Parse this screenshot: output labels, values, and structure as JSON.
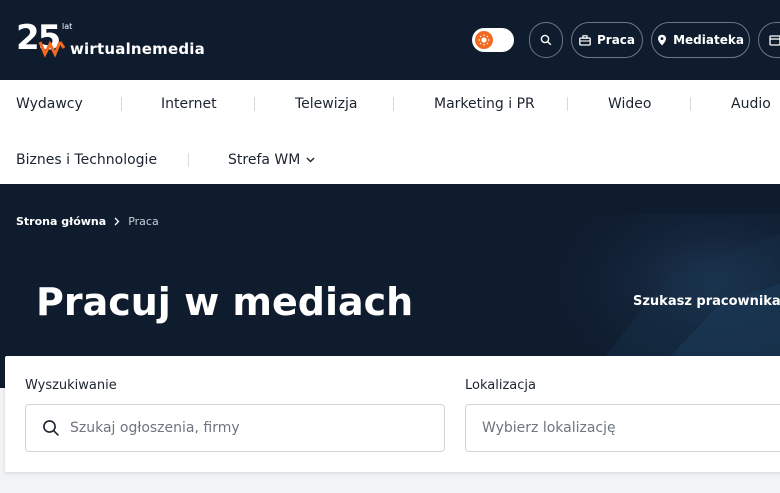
{
  "logo": {
    "number": "25",
    "suffix": "lat",
    "wordmark": "wirtualnemedia"
  },
  "header": {
    "praca_label": "Praca",
    "mediateka_label": "Mediateka"
  },
  "nav": {
    "items": [
      "Wydawcy",
      "Internet",
      "Telewizja",
      "Marketing i PR",
      "Wideo",
      "Audio",
      "Biznes i Technologie",
      "Strefa WM"
    ]
  },
  "breadcrumb": {
    "home": "Strona główna",
    "current": "Praca"
  },
  "hero": {
    "title": "Pracuj w mediach",
    "cta": "Szukasz pracownika?"
  },
  "search": {
    "label": "Wyszukiwanie",
    "placeholder": "Szukaj ogłoszenia, firmy",
    "value": ""
  },
  "location": {
    "label": "Lokalizacja",
    "placeholder": "Wybierz lokalizację",
    "value": ""
  },
  "colors": {
    "header_bg": "#0f1c2e",
    "accent": "#f26a21",
    "nav_bg": "#ffffff",
    "page_bg": "#f2f3f5"
  },
  "icons": [
    "sun-icon",
    "search-icon",
    "briefcase-icon",
    "location-pin-icon",
    "calendar-icon",
    "chevron-down-icon",
    "chevron-right-icon"
  ]
}
